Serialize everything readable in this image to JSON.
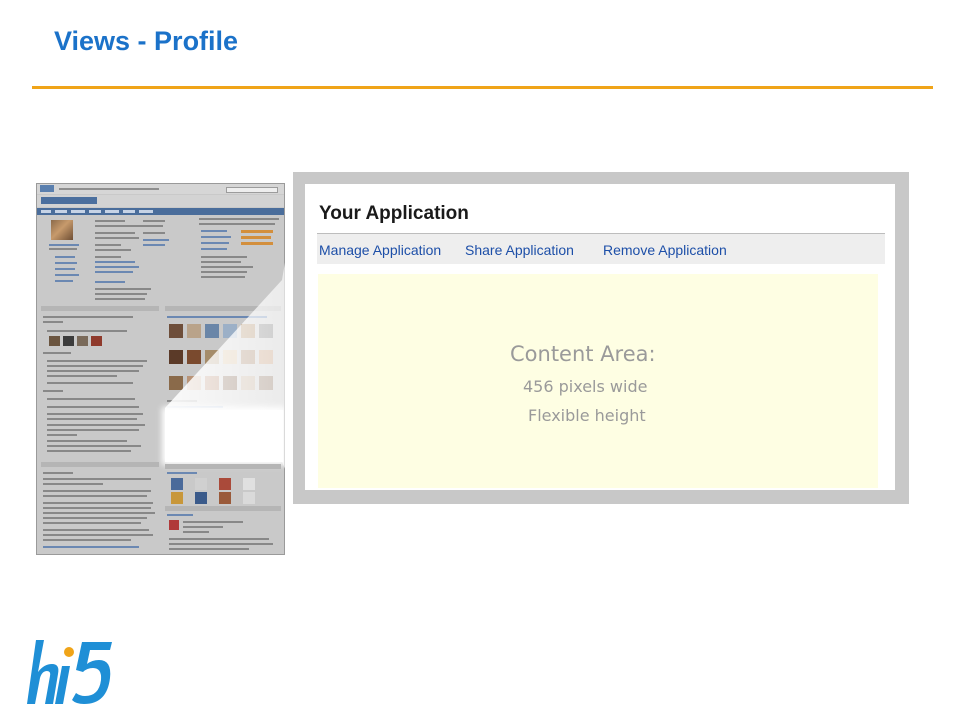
{
  "slide": {
    "title": "Views - Profile",
    "accent_color": "#f0a418",
    "title_color": "#1b72c9"
  },
  "application": {
    "title": "Your Application",
    "menu": [
      {
        "label": "Manage Application"
      },
      {
        "label": "Share Application"
      },
      {
        "label": "Remove Application"
      }
    ],
    "content_area": {
      "heading": "Content Area:",
      "line1": "456 pixels wide",
      "line2": "Flexible height",
      "background": "#fefee3"
    }
  },
  "thumbnail": {
    "description_icon": "profile-page-thumbnail"
  },
  "logo": {
    "text": "hi5",
    "color": "#1f8fd6",
    "accent": "#f0a418"
  }
}
